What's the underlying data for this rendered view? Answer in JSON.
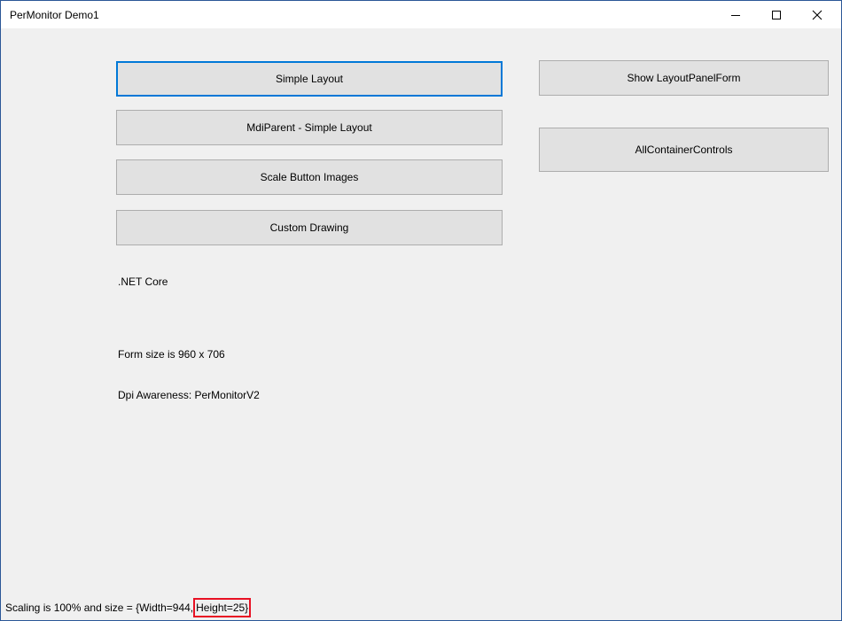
{
  "window": {
    "title": "PerMonitor Demo1"
  },
  "caption": {
    "minimize_icon": "minimize-icon",
    "maximize_icon": "maximize-icon",
    "close_icon": "close-icon"
  },
  "buttons": {
    "simple_layout": "Simple Layout",
    "mdi_parent": "MdiParent - Simple Layout",
    "scale_images": "Scale Button Images",
    "custom_drawing": "Custom Drawing",
    "layout_panel": "Show LayoutPanelForm",
    "container_controls": "AllContainerControls"
  },
  "labels": {
    "framework": ".NET Core",
    "form_size": "Form size is 960 x 706",
    "dpi_awareness": "Dpi Awareness: PerMonitorV2"
  },
  "status": {
    "prefix": "Scaling is 100% and size = {Width=944,",
    "highlighted": "Height=25}"
  },
  "colors": {
    "focus_border": "#0078d7",
    "highlight_border": "#e81123",
    "window_border": "#2b5797"
  }
}
